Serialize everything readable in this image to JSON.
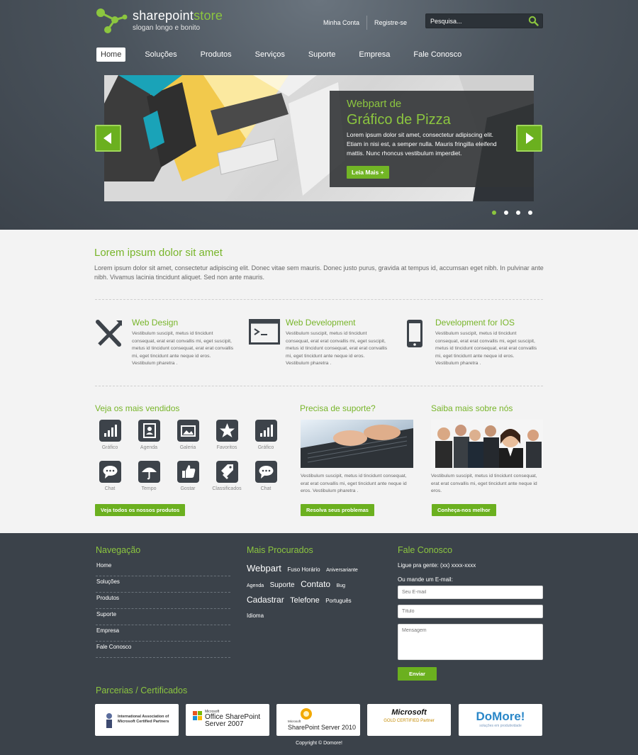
{
  "brand": {
    "name_main": "sharepoint",
    "name_accent": "store",
    "slogan": "slogan longo e bonito"
  },
  "top_links": [
    "Minha Conta",
    "Registre-se"
  ],
  "search": {
    "placeholder": "Pesquisa..."
  },
  "nav": [
    {
      "label": "Home",
      "active": true
    },
    {
      "label": "Soluções"
    },
    {
      "label": "Produtos"
    },
    {
      "label": "Serviços"
    },
    {
      "label": "Suporte"
    },
    {
      "label": "Empresa"
    },
    {
      "label": "Fale Conosco"
    }
  ],
  "slider": {
    "eyebrow": "Webpart de",
    "title": "Gráfico de Pizza",
    "text": "Lorem ipsum dolor sit amet, consectetur adipiscing elit. Etiam in nisi est, a semper nulla. Mauris fringilla eleifend mattis. Nunc rhoncus vestibulum imperdiet.",
    "button": "Leia Mais +",
    "dots": 4,
    "active_dot": 1
  },
  "intro": {
    "title": "Lorem ipsum dolor sit amet",
    "text": "Lorem ipsum dolor sit amet, consectetur adipiscing elit. Donec vitae sem mauris. Donec justo purus, gravida at tempus id, accumsan eget nibh. In pulvinar ante nibh. Vivamus lacinia tincidunt aliquet. Sed non ante mauris."
  },
  "features": [
    {
      "title": "Web Design",
      "icon": "design-tools-icon",
      "text": "Vestibulum suscipit, metus id tincidunt consequat, erat erat convallis mi, eget suscipit, metus id tincidunt consequat, erat erat convallis mi, eget tincidunt ante neque id eros. Vestibulum pharetra ."
    },
    {
      "title": "Web Development",
      "icon": "terminal-icon",
      "text": "Vestibulum suscipit, metus id tincidunt consequat, erat erat convallis mi, eget suscipit, metus id tincidunt consequat, erat erat convallis mi, eget tincidunt ante neque id eros. Vestibulum pharetra ."
    },
    {
      "title": "Development for IOS",
      "icon": "phone-icon",
      "text": "Vestibulum suscipit, metus id tincidunt consequat, erat erat convallis mi, eget suscipit, metus id tincidunt consequat, erat erat convallis mi, eget tincidunt ante neque id eros. Vestibulum pharetra ."
    }
  ],
  "bestsellers": {
    "title": "Veja os mais vendidos",
    "items": [
      "Gráfico",
      "Agenda",
      "Galeria",
      "Favoritos",
      "Gráfico",
      "Chat",
      "Tempo",
      "Gostar",
      "Classificados",
      "Chat"
    ],
    "button": "Veja todos os nossos produtos"
  },
  "support": {
    "title": "Precisa de suporte?",
    "text": "Vestibulum suscipit, metus id tincidunt consequat, erat erat convallis mi, eget tincidunt ante neque id eros. Vestibulum pharetra .",
    "button": "Resolva seus problemas"
  },
  "about": {
    "title": "Saiba mais sobre nós",
    "text": "Vestibulum suscipit, metus id tincidunt consequat, erat erat convallis mi, eget tincidunt ante neque id eros.",
    "button": "Conheça-nos melhor"
  },
  "footer": {
    "nav_title": "Navegação",
    "nav": [
      "Home",
      "Soluções",
      "Produtos",
      "Suporte",
      "Empresa",
      "Fale Conosco"
    ],
    "popular_title": "Mais Procurados",
    "tags": [
      {
        "t": "Webpart",
        "s": 13
      },
      {
        "t": "Fuso Horário",
        "s": 8
      },
      {
        "t": "Aniversariante",
        "s": 7
      },
      {
        "t": "Agenda",
        "s": 7
      },
      {
        "t": "Suporte",
        "s": 10
      },
      {
        "t": "Contato",
        "s": 12
      },
      {
        "t": "Bug",
        "s": 7
      },
      {
        "t": "Cadastrar",
        "s": 12
      },
      {
        "t": "Telefone",
        "s": 11
      },
      {
        "t": "Português",
        "s": 8
      },
      {
        "t": "Idioma",
        "s": 8
      }
    ],
    "contact_title": "Fale Conosco",
    "phone": "Ligue pra gente: (xx) xxxx-xxxx",
    "email_label": "Ou mande um E-mail:",
    "email_placeholder": "Seu E-mail",
    "subject_placeholder": "Título",
    "message_placeholder": "Mensagem",
    "send": "Enviar",
    "partners_title": "Parcerias / Certificados",
    "partners": [
      {
        "l1": "International Association of",
        "l2": "Microsoft Certified Partners"
      },
      {
        "l1": "Microsoft",
        "l2": "Office SharePoint Server 2007"
      },
      {
        "l1": "Microsoft",
        "l2": "SharePoint Server 2010"
      },
      {
        "l1": "Microsoft",
        "l2": "GOLD CERTIFIED Partner"
      },
      {
        "l1": "DoMore!",
        "l2": "soluções em produtividade"
      }
    ],
    "copyright": "Copyright © Domore!"
  },
  "colors": {
    "accent": "#8cc63f",
    "button": "#6bb01f",
    "header_bg": "#4b545d",
    "footer_bg": "#3b424a"
  }
}
